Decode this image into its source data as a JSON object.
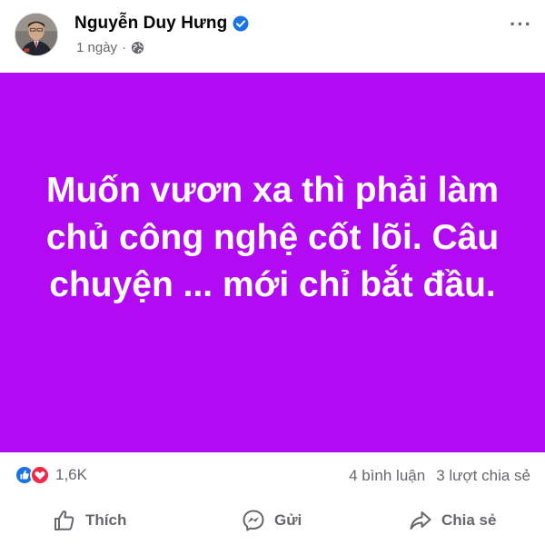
{
  "post": {
    "author_name": "Nguyễn Duy Hưng",
    "time": "1 ngày",
    "separator": "·",
    "content": "Muốn vươn xa thì phải làm chủ công nghệ cốt lõi. Câu chuyện ... mới chỉ bắt đầu.",
    "background_color": "#b20bf3"
  },
  "stats": {
    "reaction_count": "1,6K",
    "comments": "4 bình luận",
    "shares": "3 lượt chia sẻ"
  },
  "actions": {
    "like_label": "Thích",
    "send_label": "Gửi",
    "share_label": "Chia sẻ"
  },
  "icons": {
    "verified": "verified-badge-icon",
    "audience": "globe-icon",
    "more": "more-options-icon",
    "like_reaction": "thumbs-up-icon",
    "love_reaction": "heart-icon",
    "like_action": "thumbs-up-outline-icon",
    "send_action": "messenger-icon",
    "share_action": "share-arrow-icon"
  },
  "colors": {
    "accent": "#1b74e4",
    "love": "#f0284a",
    "secondary_text": "#65676b"
  }
}
